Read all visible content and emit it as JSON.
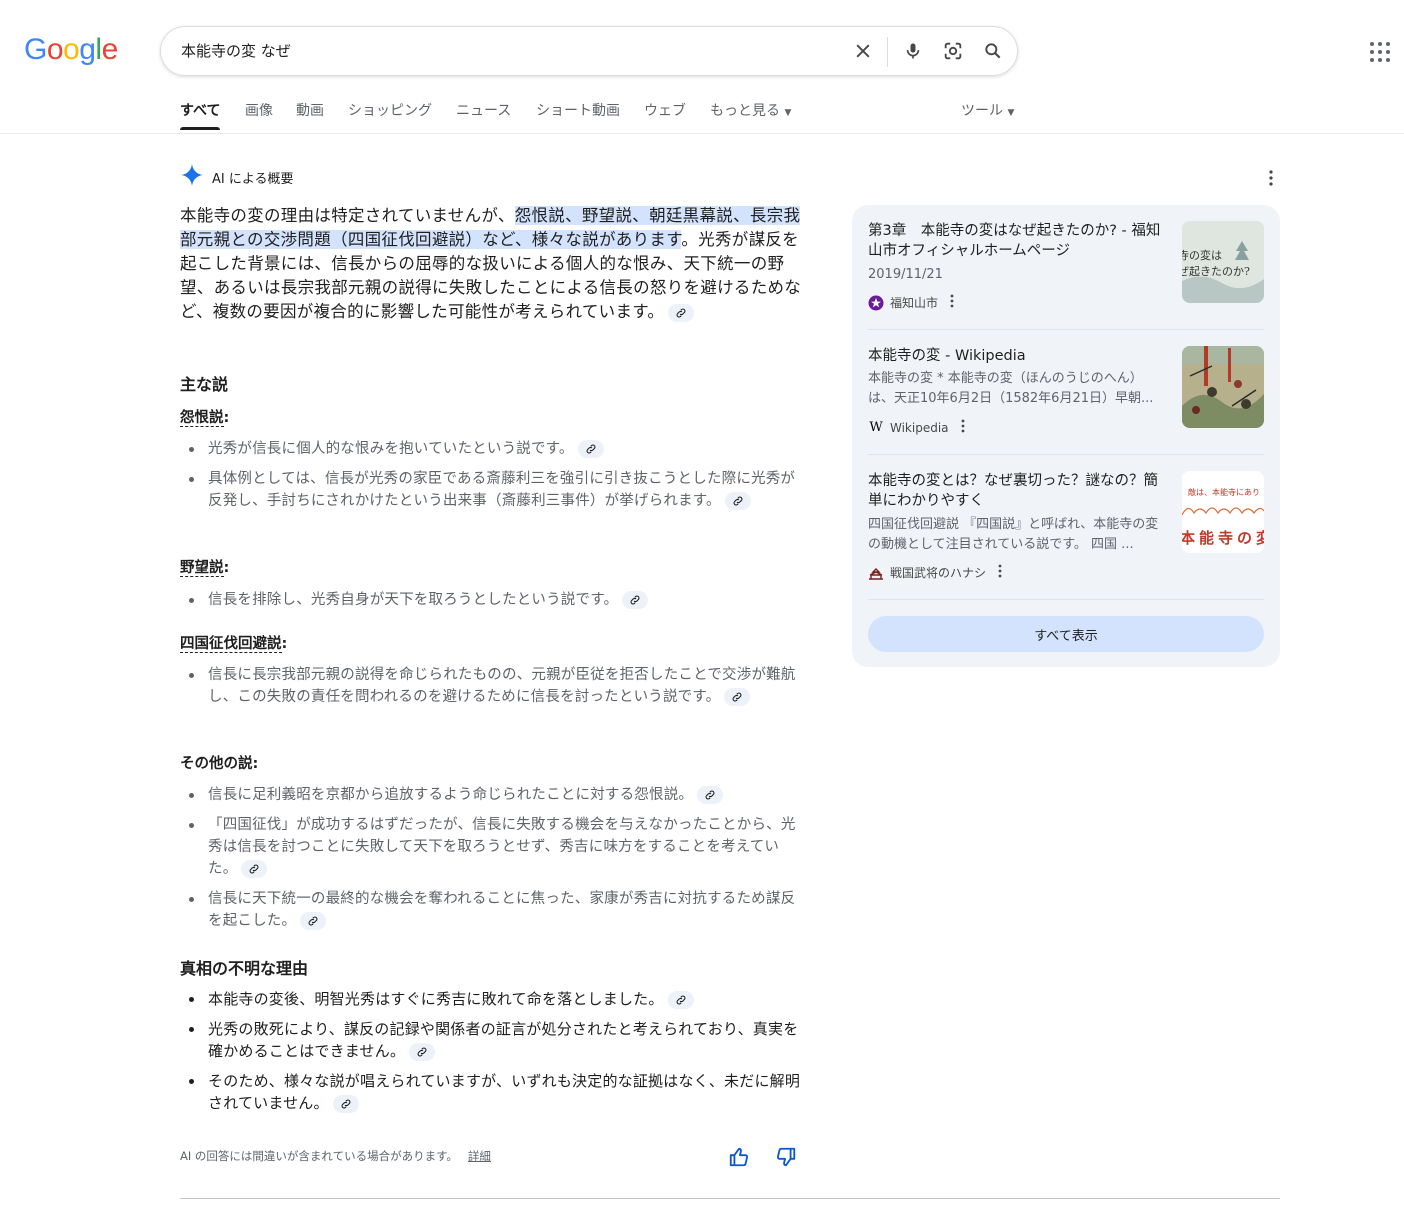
{
  "header": {
    "logo": [
      "G",
      "o",
      "o",
      "g",
      "l",
      "e"
    ],
    "logo_colors": [
      "#4285f4",
      "#ea4335",
      "#fbbc05",
      "#4285f4",
      "#34a853",
      "#ea4335"
    ],
    "query": "本能寺の変 なぜ",
    "icons": [
      "close-icon",
      "mic-icon",
      "lens-icon",
      "search-icon",
      "apps-grid-icon"
    ]
  },
  "tabs": [
    {
      "label": "すべて",
      "active": true
    },
    {
      "label": "画像"
    },
    {
      "label": "動画"
    },
    {
      "label": "ショッピング"
    },
    {
      "label": "ニュース"
    },
    {
      "label": "ショート動画"
    },
    {
      "label": "ウェブ"
    },
    {
      "label": "もっと見る"
    },
    {
      "label": "ツール"
    }
  ],
  "ai": {
    "title": "AI による概要",
    "summary_pre": "本能寺の変の理由は特定されていませんが、",
    "summary_hl": "怨恨説、野望説、朝廷黒幕説、長宗我部元親との交渉問題（四国征伐回避説）など、様々な説があります",
    "summary_post": "。光秀が謀反を起こした背景には、信長からの屈辱的な扱いによる個人的な恨み、天下統一の野望、あるいは長宗我部元親の説得に失敗したことによる信長の怒りを避けるためなど、複数の要因が複合的に影響した可能性が考えられています。",
    "section1_title": "主な説",
    "theory1": {
      "title": "怨恨説",
      "items": [
        "光秀が信長に個人的な恨みを抱いていたという説です。",
        "具体例としては、信長が光秀の家臣である斎藤利三を強引に引き抜こうとした際に光秀が反発し、手討ちにされかけたという出来事（斎藤利三事件）が挙げられます。"
      ]
    },
    "theory2": {
      "title": "野望説",
      "items": [
        "信長を排除し、光秀自身が天下を取ろうとしたという説です。"
      ]
    },
    "theory3": {
      "title": "四国征伐回避説",
      "items": [
        "信長に長宗我部元親の説得を命じられたものの、元親が臣従を拒否したことで交渉が難航し、この失敗の責任を問われるのを避けるために信長を討ったという説です。"
      ]
    },
    "theory4": {
      "title": "その他の説",
      "items": [
        "信長に足利義昭を京都から追放するよう命じられたことに対する怨恨説。",
        "「四国征伐」が成功するはずだったが、信長に失敗する機会を与えなかったことから、光秀は信長を討つことに失敗して天下を取ろうとせず、秀吉に味方をすることを考えていた。",
        "信長に天下統一の最終的な機会を奪われることに焦った、家康が秀吉に対抗するため謀反を起こした。"
      ]
    },
    "section2_title": "真相の不明な理由",
    "reasons": [
      "本能寺の変後、明智光秀はすぐに秀吉に敗れて命を落としました。",
      "光秀の敗死により、謀反の記録や関係者の証言が処分されたと考えられており、真実を確かめることはできません。",
      "そのため、様々な説が唱えられていますが、いずれも決定的な証拠はなく、未だに解明されていません。"
    ],
    "disclaimer": "AI の回答には間違いが含まれている場合があります。",
    "disclaimer_link": "詳細"
  },
  "sources": [
    {
      "title": "第3章　本能寺の変はなぜ起きたのか? - 福知山市オフィシャルホームページ",
      "date": "2019/11/21",
      "site": "福知山市",
      "thumb_text": "寺の変は\nぜ起きたのか?"
    },
    {
      "title": "本能寺の変 - Wikipedia",
      "snippet": "本能寺の変 * 本能寺の変（ほんのうじのへん）は、天正10年6月2日（1582年6月21日）早朝...",
      "site": "Wikipedia"
    },
    {
      "title": "本能寺の変とは？なぜ裏切った？謎なの？簡単にわかりやすく",
      "snippet": "四国征伐回避説 『四国説』と呼ばれ、本能寺の変の動機として注目されている説です。 四国 ...",
      "site": "戦国武将のハナシ",
      "thumb_text_top": "敵は、本能寺にあり",
      "thumb_text_big": "本能寺の変"
    }
  ],
  "show_all": "すべて表示"
}
